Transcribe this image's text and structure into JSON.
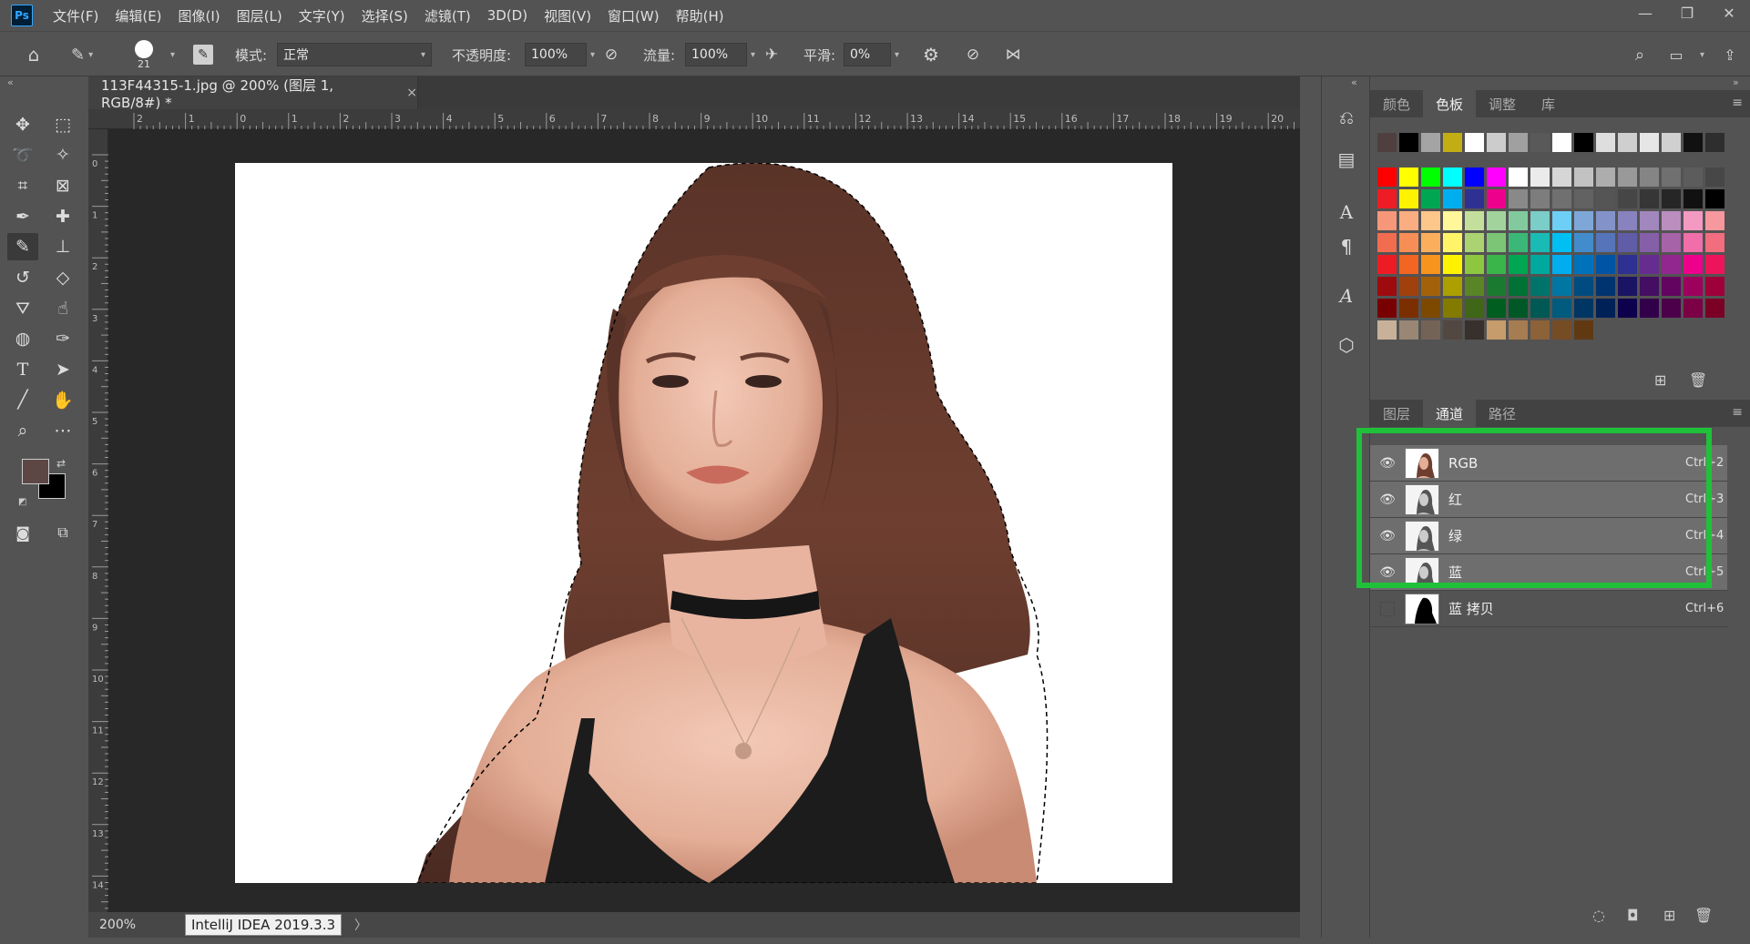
{
  "app": {
    "logo": "Ps"
  },
  "menu": [
    "文件(F)",
    "编辑(E)",
    "图像(I)",
    "图层(L)",
    "文字(Y)",
    "选择(S)",
    "滤镜(T)",
    "3D(D)",
    "视图(V)",
    "窗口(W)",
    "帮助(H)"
  ],
  "window_controls": {
    "minimize": "—",
    "restore": "❐",
    "close": "✕"
  },
  "options": {
    "brush_size": "21",
    "mode_label": "模式:",
    "mode_value": "正常",
    "opacity_label": "不透明度:",
    "opacity_value": "100%",
    "flow_label": "流量:",
    "flow_value": "100%",
    "smoothing_label": "平滑:",
    "smoothing_value": "0%"
  },
  "document": {
    "tab_title": "113F44315-1.jpg @ 200% (图层 1, RGB/8#) *",
    "close": "×",
    "ruler_h": [
      "2",
      "1",
      "0",
      "1",
      "2",
      "3",
      "4",
      "5",
      "6",
      "7",
      "8",
      "9",
      "10",
      "11",
      "12",
      "13",
      "14",
      "15",
      "16",
      "17",
      "18",
      "19",
      "20"
    ],
    "ruler_v": [
      "0",
      "1",
      "2",
      "3",
      "4",
      "5",
      "6",
      "7",
      "8",
      "9",
      "10",
      "11",
      "12",
      "13",
      "14"
    ],
    "zoom": "200%",
    "tooltip": "IntelliJ IDEA 2019.3.3",
    "status_arrow": "〉"
  },
  "swatches_panel": {
    "tabs": [
      "颜色",
      "色板",
      "调整",
      "库"
    ],
    "active_tab": "色板",
    "recent": [
      "#4f3f3f",
      "#000000",
      "#a4a4a4",
      "#c3ad15",
      "#ffffff",
      "#cccccc",
      "#a0a0a0",
      "#595959",
      "#ffffff",
      "#000000",
      "#dedede",
      "#cfcfcf",
      "#e6e6e6",
      "#d0d0d0",
      "#111111",
      "#2e2e2e"
    ],
    "rows": [
      [
        "#ff0000",
        "#ffff00",
        "#00ff00",
        "#00ffff",
        "#0000ff",
        "#ff00ff",
        "#ffffff",
        "#ebebeb",
        "#d6d6d6",
        "#c2c2c2",
        "#adadad",
        "#999999",
        "#858585",
        "#707070",
        "#5c5c5c",
        "#474747"
      ],
      [
        "#ee1c24",
        "#fff200",
        "#00a651",
        "#00aeef",
        "#2e3192",
        "#ec008c",
        "#898989",
        "#7d7d7d",
        "#707070",
        "#626262",
        "#555555",
        "#464646",
        "#363636",
        "#262626",
        "#111111",
        "#000000"
      ],
      [
        "#f7977a",
        "#f9ad81",
        "#fdc68a",
        "#fff79a",
        "#c4df9b",
        "#a3d39c",
        "#82ca9d",
        "#7bcdc8",
        "#6ecff6",
        "#7ea7d8",
        "#8393ca",
        "#8882be",
        "#a187be",
        "#bc8dbf",
        "#f49ac2",
        "#f6989d"
      ],
      [
        "#f26c4f",
        "#f68e55",
        "#fbaf5c",
        "#fff467",
        "#acd372",
        "#7cc576",
        "#3bb878",
        "#1abbb4",
        "#00bff3",
        "#438ccb",
        "#5574b9",
        "#605ca8",
        "#855fa8",
        "#a763a8",
        "#f06ea9",
        "#f26d7d"
      ],
      [
        "#ed1c24",
        "#f26522",
        "#f7941d",
        "#fff200",
        "#8dc63f",
        "#39b54a",
        "#00a651",
        "#00a99d",
        "#00aeef",
        "#0072bc",
        "#0054a6",
        "#2e3192",
        "#662d91",
        "#92278f",
        "#ec008c",
        "#ed145b"
      ],
      [
        "#9e0b0f",
        "#a0410d",
        "#a3620a",
        "#aba000",
        "#598527",
        "#1a7b30",
        "#007236",
        "#00746b",
        "#0076a3",
        "#004b80",
        "#003471",
        "#1b1464",
        "#440e62",
        "#630460",
        "#9e005d",
        "#9e0039"
      ],
      [
        "#790000",
        "#7b2e00",
        "#7d4900",
        "#827b00",
        "#406618",
        "#005e20",
        "#005826",
        "#005952",
        "#005b7f",
        "#003663",
        "#002157",
        "#0d004c",
        "#32004b",
        "#4b0049",
        "#7b0046",
        "#7a0026"
      ],
      [
        "#c7b299",
        "#998675",
        "#736357",
        "#534741",
        "#37302d",
        "#c69c6d",
        "#a67c52",
        "#8c6239",
        "#754c24",
        "#603913"
      ]
    ],
    "foot_icons": [
      "new-swatch-icon",
      "trash-icon"
    ]
  },
  "channels_panel": {
    "tabs": [
      "图层",
      "通道",
      "路径"
    ],
    "active_tab": "通道",
    "rows": [
      {
        "name": "RGB",
        "shortcut": "Ctrl+2",
        "visible": true,
        "selected": true,
        "thumb": "color"
      },
      {
        "name": "红",
        "shortcut": "Ctrl+3",
        "visible": true,
        "selected": true,
        "thumb": "gray"
      },
      {
        "name": "绿",
        "shortcut": "Ctrl+4",
        "visible": true,
        "selected": true,
        "thumb": "gray"
      },
      {
        "name": "蓝",
        "shortcut": "Ctrl+5",
        "visible": true,
        "selected": true,
        "thumb": "gray"
      },
      {
        "name": "蓝 拷贝",
        "shortcut": "Ctrl+6",
        "visible": false,
        "selected": false,
        "thumb": "mask"
      }
    ],
    "highlight_color": "#1fc13b"
  },
  "colors": {
    "foreground": "#5d4745",
    "background": "#000000",
    "accent_highlight": "#1fc13b"
  }
}
